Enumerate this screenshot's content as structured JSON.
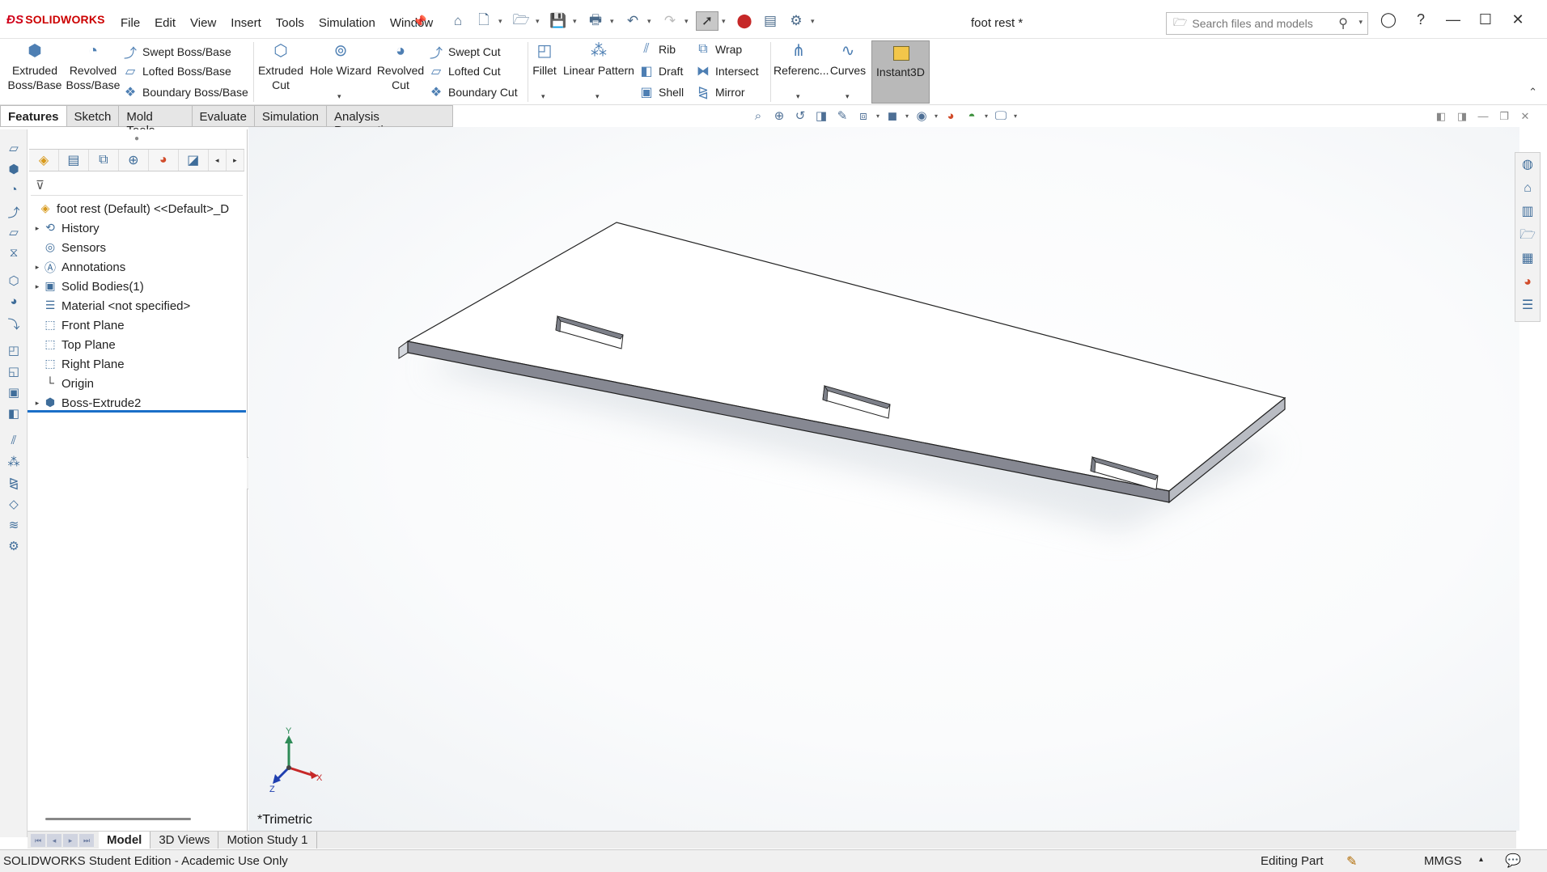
{
  "app": {
    "brand": "SOLIDWORKS",
    "menu": [
      "File",
      "Edit",
      "View",
      "Insert",
      "Tools",
      "Simulation",
      "Window"
    ],
    "doc_title": "foot rest *",
    "search_placeholder": "Search files and models"
  },
  "ribbon": {
    "extruded_boss": [
      "Extruded",
      "Boss/Base"
    ],
    "revolved_boss": [
      "Revolved",
      "Boss/Base"
    ],
    "swept_boss": "Swept Boss/Base",
    "lofted_boss": "Lofted Boss/Base",
    "boundary_boss": "Boundary Boss/Base",
    "extruded_cut": [
      "Extruded",
      "Cut"
    ],
    "hole_wizard": "Hole Wizard",
    "revolved_cut": [
      "Revolved",
      "Cut"
    ],
    "swept_cut": "Swept Cut",
    "lofted_cut": "Lofted Cut",
    "boundary_cut": "Boundary Cut",
    "fillet": "Fillet",
    "linear_pattern": "Linear Pattern",
    "rib": "Rib",
    "draft": "Draft",
    "shell": "Shell",
    "wrap": "Wrap",
    "intersect": "Intersect",
    "mirror": "Mirror",
    "reference": "Referenc...",
    "curves": "Curves",
    "instant3d": "Instant3D"
  },
  "tabs": [
    "Features",
    "Sketch",
    "Mold Tools",
    "Evaluate",
    "Simulation",
    "Analysis Preparation"
  ],
  "tree": {
    "root": "foot rest (Default) <<Default>_D",
    "items": [
      {
        "label": "History",
        "expandable": true,
        "icon": "history-icon"
      },
      {
        "label": "Sensors",
        "expandable": false,
        "icon": "sensors-icon"
      },
      {
        "label": "Annotations",
        "expandable": true,
        "icon": "annotations-icon"
      },
      {
        "label": "Solid Bodies(1)",
        "expandable": true,
        "icon": "solid-bodies-icon"
      },
      {
        "label": "Material <not specified>",
        "expandable": false,
        "icon": "material-icon"
      },
      {
        "label": "Front Plane",
        "expandable": false,
        "icon": "plane-icon"
      },
      {
        "label": "Top Plane",
        "expandable": false,
        "icon": "plane-icon"
      },
      {
        "label": "Right Plane",
        "expandable": false,
        "icon": "plane-icon"
      },
      {
        "label": "Origin",
        "expandable": false,
        "icon": "origin-icon"
      },
      {
        "label": "Boss-Extrude2",
        "expandable": true,
        "icon": "extrude-icon"
      }
    ]
  },
  "viewport": {
    "view_label": "*Trimetric",
    "triad": {
      "x": "X",
      "y": "Y",
      "z": "Z"
    }
  },
  "bottom_tabs": [
    "Model",
    "3D Views",
    "Motion Study 1"
  ],
  "status": {
    "edition": "SOLIDWORKS Student Edition - Academic Use Only",
    "mode": "Editing Part",
    "units": "MMGS"
  },
  "colors": {
    "accent": "#1a6fc8",
    "brand": "#d0021b",
    "icon_blue": "#4e7fb3"
  }
}
